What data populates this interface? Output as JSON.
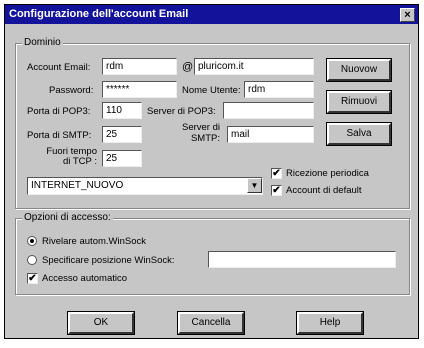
{
  "window": {
    "title": "Configurazione dell'account Email",
    "close_glyph": "×"
  },
  "dominio": {
    "label": "Dominio",
    "account_email_label": "Account Email:",
    "account_email_value": "rdm",
    "at_sign": "@",
    "domain_value": "pluricom.it",
    "password_label": "Password:",
    "password_value": "******",
    "nome_utente_label": "Nome Utente:",
    "nome_utente_value": "rdm",
    "porta_pop3_label": "Porta di POP3:",
    "porta_pop3_value": "110",
    "server_pop3_label": "Server di POP3:",
    "server_pop3_value": "",
    "porta_smtp_label": "Porta di SMTP:",
    "porta_smtp_value": "25",
    "server_smtp_label_1": "Server di",
    "server_smtp_label_2": "SMTP:",
    "server_smtp_value": "mail",
    "fuori_tempo_label_1": "Fuori tempo",
    "fuori_tempo_label_2": "di TCP :",
    "fuori_tempo_value": "25",
    "connection_value": "INTERNET_NUOVO",
    "ricezione_periodica_label": "Ricezione periodica",
    "ricezione_periodica_checked": true,
    "account_default_label": "Account di  default",
    "account_default_checked": true
  },
  "side_buttons": {
    "nuovo": "Nuovow",
    "rimuovi": "Rimuovi",
    "salva": "Salva"
  },
  "accesso": {
    "label": "Opzioni di accesso:",
    "radio1_label": "Rivelare autom.WinSock",
    "radio1_selected": true,
    "radio2_label": "Specificare posizione WinSock:",
    "radio2_value": "",
    "accesso_auto_label": "Accesso automatico",
    "accesso_auto_checked": true
  },
  "bottom_buttons": {
    "ok": "OK",
    "cancella": "Cancella",
    "help": "Help"
  },
  "colors": {
    "title_bar": "#12129a",
    "face": "#c6c6c6"
  },
  "icons": {
    "check": "✔",
    "dropdown": "▼"
  }
}
